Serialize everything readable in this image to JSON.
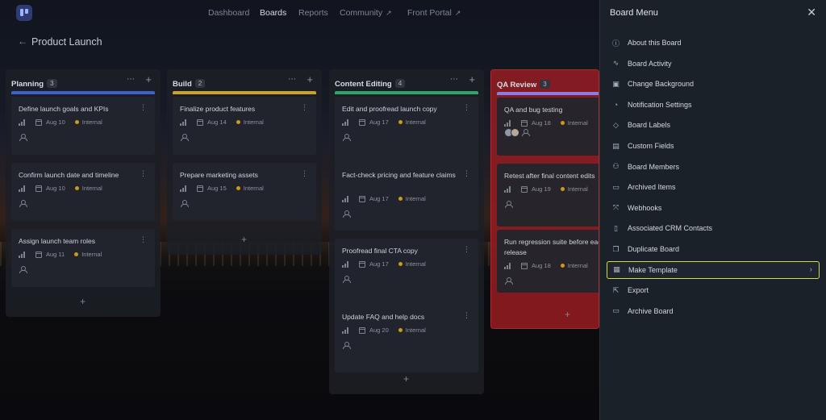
{
  "nav": {
    "items": [
      {
        "label": "Dashboard",
        "active": false,
        "external": false
      },
      {
        "label": "Boards",
        "active": true,
        "external": false
      },
      {
        "label": "Reports",
        "active": false,
        "external": false
      },
      {
        "label": "Community",
        "active": false,
        "external": true
      },
      {
        "label": "Front Portal",
        "active": false,
        "external": true
      }
    ],
    "external_glyph": "↗"
  },
  "board": {
    "back_glyph": "←",
    "title": "Product Launch"
  },
  "columns": [
    {
      "title": "Planning",
      "count": "3",
      "bar_color": "#3d63c9",
      "cards": [
        {
          "title": "Define launch goals and KPIs",
          "date": "Aug 10",
          "tag": "Internal"
        },
        {
          "title": "Confirm launch date and timeline",
          "date": "Aug 10",
          "tag": "Internal"
        },
        {
          "title": "Assign launch team roles",
          "date": "Aug 11",
          "tag": "Internal"
        }
      ]
    },
    {
      "title": "Build",
      "count": "2",
      "bar_color": "#c9a227",
      "cards": [
        {
          "title": "Finalize product features",
          "date": "Aug 14",
          "tag": "Internal"
        },
        {
          "title": "Prepare marketing assets",
          "date": "Aug 15",
          "tag": "Internal"
        }
      ]
    },
    {
      "title": "Content Editing",
      "count": "4",
      "bar_color": "#2ea56a",
      "cards": [
        {
          "title": "Edit and proofread launch copy",
          "date": "Aug 17",
          "tag": "Internal"
        },
        {
          "title": "Fact-check pricing and feature claims",
          "date": "Aug 17",
          "tag": "Internal"
        },
        {
          "title": "Proofread final CTA copy",
          "date": "Aug 17",
          "tag": "Internal"
        },
        {
          "title": "Update FAQ and help docs",
          "date": "Aug 20",
          "tag": "Internal"
        }
      ]
    },
    {
      "title": "QA Review",
      "count": "3",
      "bar_color": "#8e7be0",
      "highlight_color": "#b0282d",
      "cards": [
        {
          "title": "QA and bug testing",
          "date": "Aug 18",
          "tag": "Internal"
        },
        {
          "title": "Retest after final content edits",
          "date": "Aug 19",
          "tag": "Internal"
        },
        {
          "title": "Run regression suite before each release",
          "date": "Aug 18",
          "tag": "Internal"
        }
      ]
    }
  ],
  "icons": {
    "more": "⋯",
    "card_more": "⋮",
    "add": "+",
    "close": "✕",
    "chevron": "›"
  },
  "panel": {
    "title": "Board Menu",
    "items": [
      {
        "label": "About this Board",
        "icon": "info-icon"
      },
      {
        "label": "Board Activity",
        "icon": "activity-icon"
      },
      {
        "label": "Change Background",
        "icon": "image-icon"
      },
      {
        "label": "Notification Settings",
        "icon": "bell-icon"
      },
      {
        "label": "Board Labels",
        "icon": "tag-icon"
      },
      {
        "label": "Custom Fields",
        "icon": "fields-icon"
      },
      {
        "label": "Board Members",
        "icon": "users-icon"
      },
      {
        "label": "Archived Items",
        "icon": "archive-icon"
      },
      {
        "label": "Webhooks",
        "icon": "webhook-icon"
      },
      {
        "label": "Associated CRM Contacts",
        "icon": "contacts-icon"
      },
      {
        "label": "Duplicate Board",
        "icon": "duplicate-icon"
      },
      {
        "label": "Make Template",
        "icon": "template-icon",
        "highlighted": true
      },
      {
        "label": "Export",
        "icon": "export-icon"
      },
      {
        "label": "Archive Board",
        "icon": "archive-box-icon"
      }
    ]
  }
}
